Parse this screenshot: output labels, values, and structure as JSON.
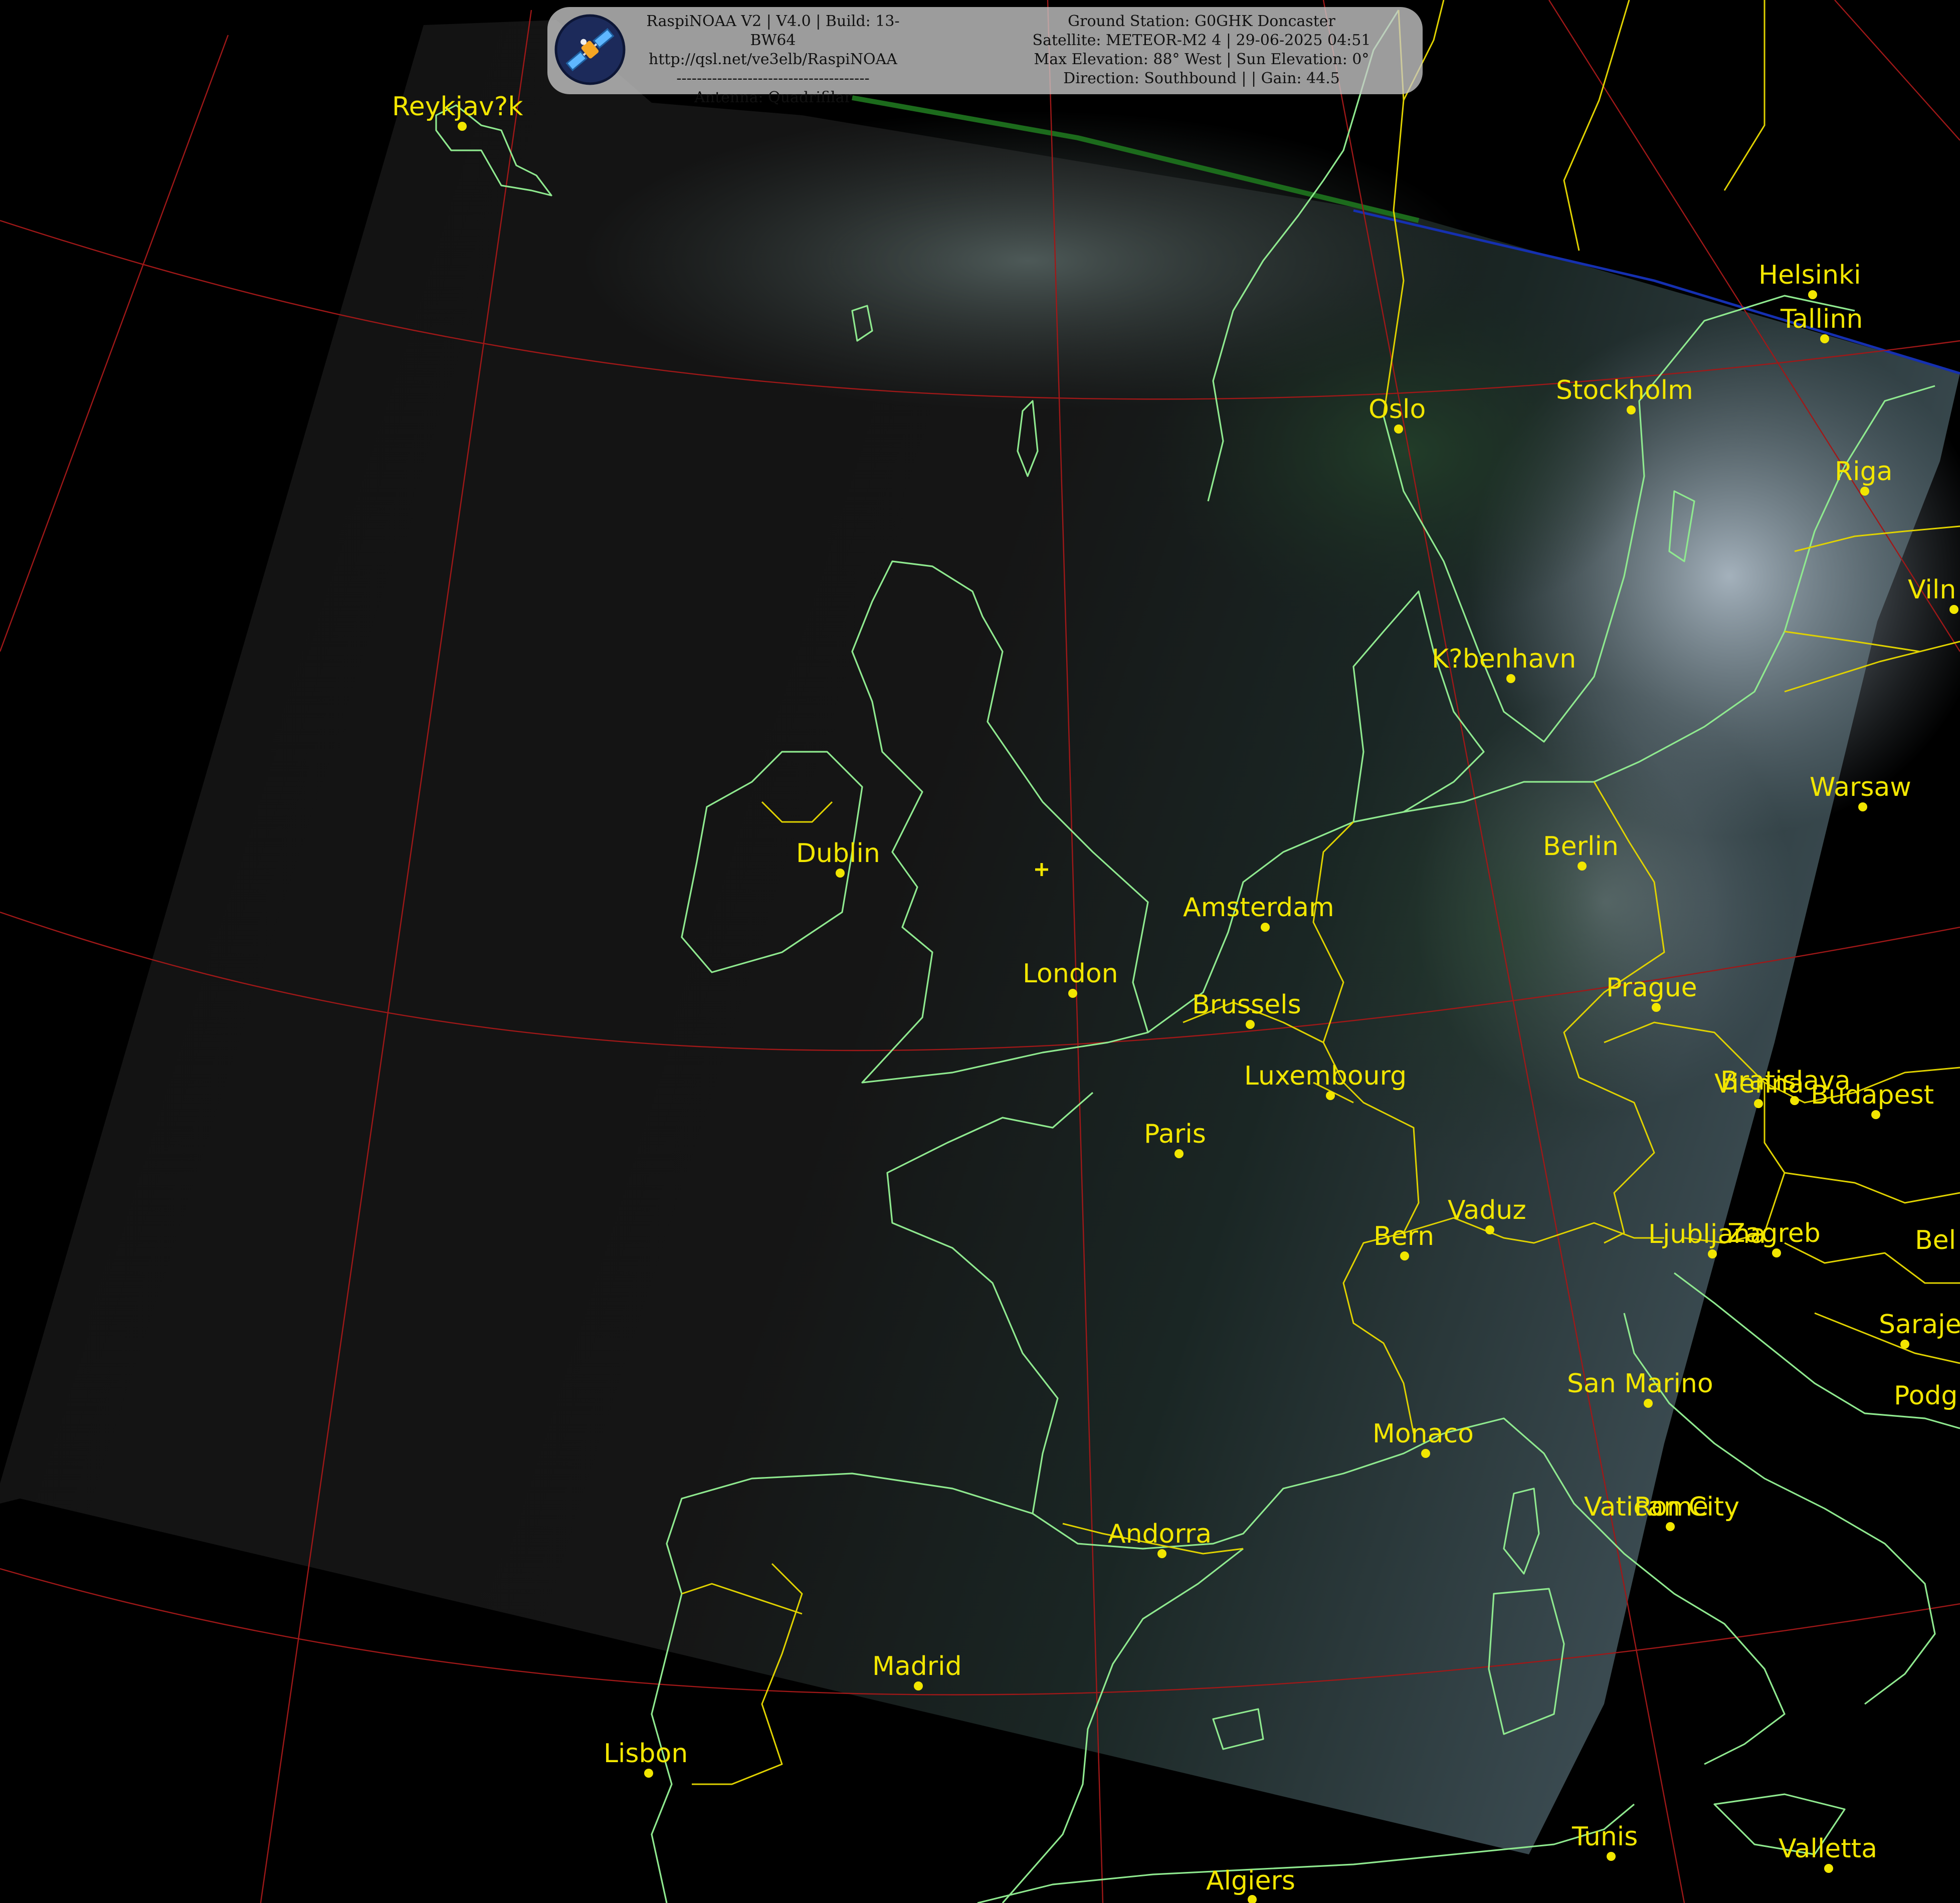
{
  "banner": {
    "left_lines": [
      "RaspiNOAA V2 | V4.0 | Build: 13-BW64",
      "http://qsl.net/ve3elb/RaspiNOAA",
      "--------------------------------------",
      "Antenna: Quadrifilar"
    ],
    "right_lines": [
      "Ground Station: G0GHK Doncaster",
      "Satellite: METEOR-M2 4 | 29-06-2025 04:51",
      "Max Elevation: 88° West | Sun Elevation: 0°",
      "Direction: Southbound | | Gain: 44.5"
    ],
    "logo_icon": "satellite-icon"
  },
  "cities": [
    {
      "name": "Reykjav?k"
    },
    {
      "name": "Helsinki"
    },
    {
      "name": "Tallinn"
    },
    {
      "name": "Oslo"
    },
    {
      "name": "Stockholm"
    },
    {
      "name": "Riga"
    },
    {
      "name": "Viln"
    },
    {
      "name": "K?benhavn"
    },
    {
      "name": "Warsaw"
    },
    {
      "name": "Dublin"
    },
    {
      "name": "Berlin"
    },
    {
      "name": "Amsterdam"
    },
    {
      "name": "London"
    },
    {
      "name": "Brussels"
    },
    {
      "name": "Prague"
    },
    {
      "name": "Luxembourg"
    },
    {
      "name": "Bratislava"
    },
    {
      "name": "Vienna"
    },
    {
      "name": "Budapest"
    },
    {
      "name": "Paris"
    },
    {
      "name": "Vaduz"
    },
    {
      "name": "Bern"
    },
    {
      "name": "Ljubljana"
    },
    {
      "name": "Zagreb"
    },
    {
      "name": "Bel"
    },
    {
      "name": "Sarajevo"
    },
    {
      "name": "San Marino"
    },
    {
      "name": "Podg"
    },
    {
      "name": "Monaco"
    },
    {
      "name": "Vatican City"
    },
    {
      "name": "Rome"
    },
    {
      "name": "Andorra"
    },
    {
      "name": "Madrid"
    },
    {
      "name": "Lisbon"
    },
    {
      "name": "Tunis"
    },
    {
      "name": "Valletta"
    },
    {
      "name": "Algiers"
    }
  ],
  "colors": {
    "background": "#000000",
    "label": "#f2e600",
    "coastline": "#8fe98f",
    "border": "#e0d200",
    "graticule": "#a01818"
  }
}
